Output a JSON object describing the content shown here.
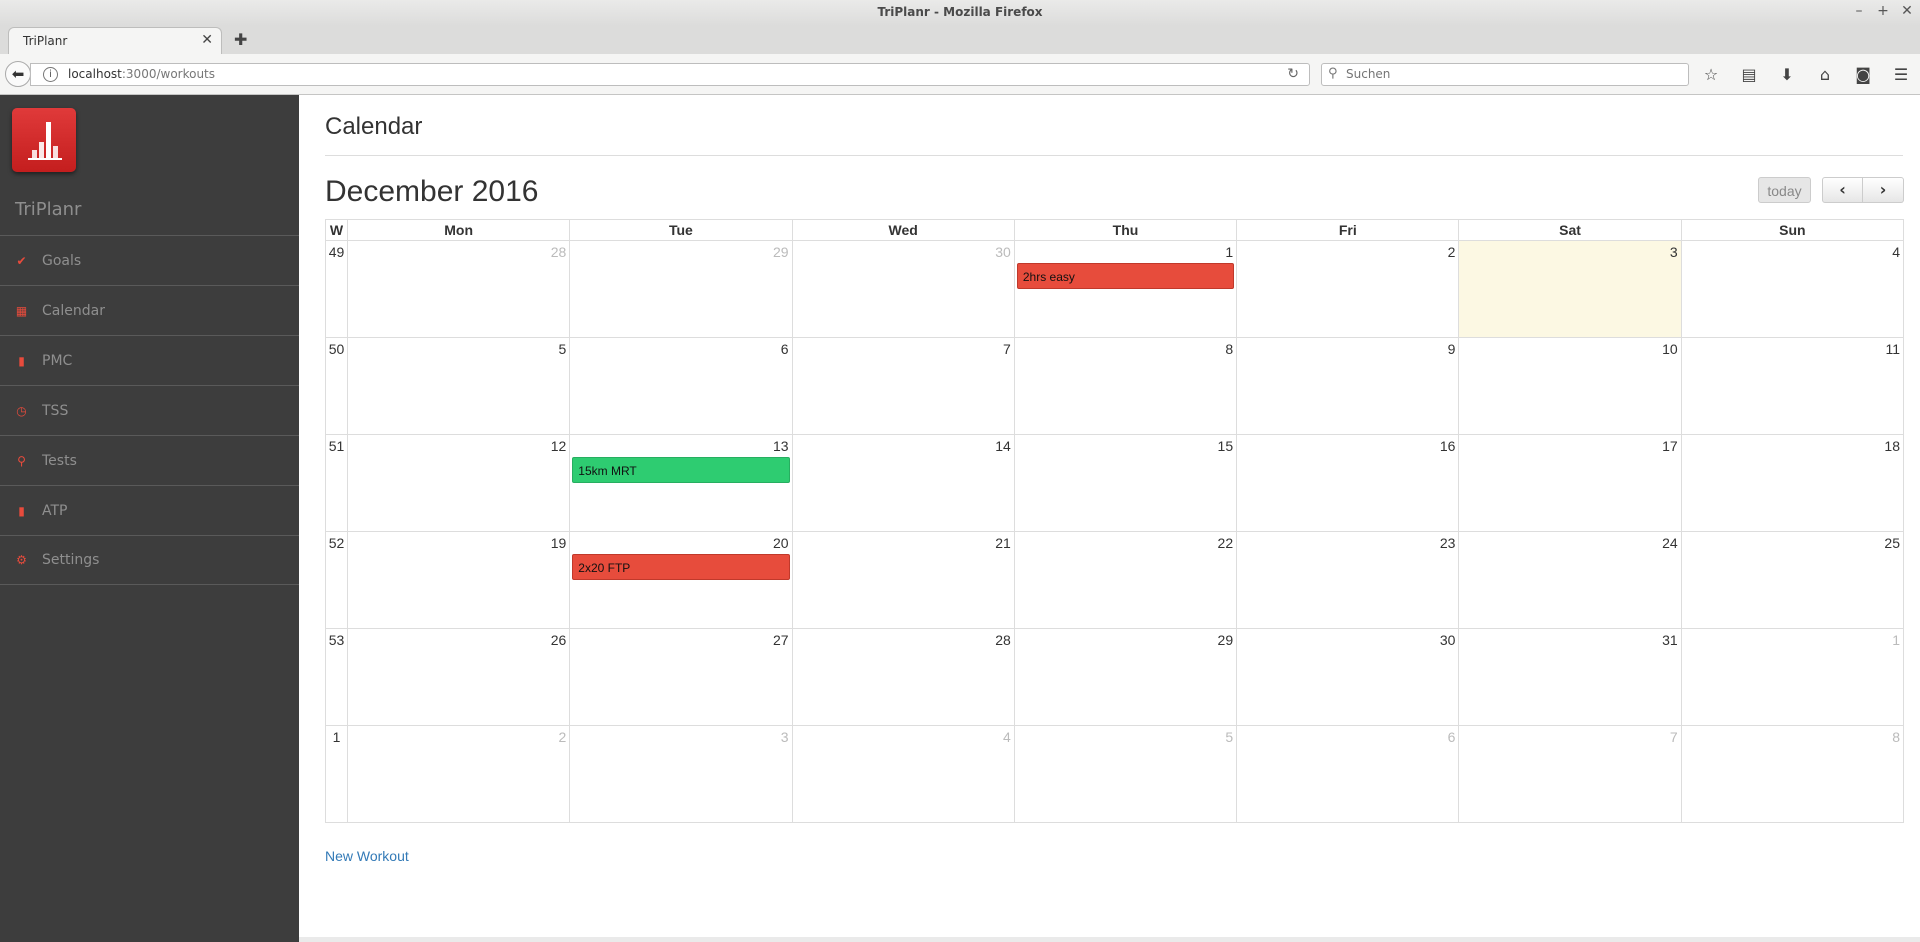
{
  "window": {
    "title": "TriPlanr - Mozilla Firefox"
  },
  "browser": {
    "tab_title": "TriPlanr",
    "url_host": "localhost",
    "url_path": ":3000/workouts",
    "search_placeholder": "Suchen"
  },
  "sidebar": {
    "brand": "TriPlanr",
    "items": [
      {
        "label": "Goals",
        "icon": "check-circle-icon"
      },
      {
        "label": "Calendar",
        "icon": "calendar-icon"
      },
      {
        "label": "PMC",
        "icon": "signal-bars-icon"
      },
      {
        "label": "TSS",
        "icon": "dashboard-icon"
      },
      {
        "label": "Tests",
        "icon": "search-icon"
      },
      {
        "label": "ATP",
        "icon": "bar-chart-icon"
      },
      {
        "label": "Settings",
        "icon": "gear-icon"
      }
    ]
  },
  "main": {
    "page_title": "Calendar",
    "month_title": "December 2016",
    "today_label": "today",
    "prev_label": "‹",
    "next_label": "›",
    "new_workout_label": "New Workout"
  },
  "calendar": {
    "headers": [
      "W",
      "Mon",
      "Tue",
      "Wed",
      "Thu",
      "Fri",
      "Sat",
      "Sun"
    ],
    "weeks": [
      {
        "week": "49",
        "days": [
          {
            "d": "28",
            "other": true
          },
          {
            "d": "29",
            "other": true
          },
          {
            "d": "30",
            "other": true
          },
          {
            "d": "1",
            "event": {
              "title": "2hrs easy",
              "color": "#e74c3c"
            }
          },
          {
            "d": "2"
          },
          {
            "d": "3",
            "today": true
          },
          {
            "d": "4"
          }
        ]
      },
      {
        "week": "50",
        "days": [
          {
            "d": "5"
          },
          {
            "d": "6"
          },
          {
            "d": "7"
          },
          {
            "d": "8"
          },
          {
            "d": "9"
          },
          {
            "d": "10"
          },
          {
            "d": "11"
          }
        ]
      },
      {
        "week": "51",
        "days": [
          {
            "d": "12"
          },
          {
            "d": "13",
            "event": {
              "title": "15km MRT",
              "color": "#2ecc71"
            }
          },
          {
            "d": "14"
          },
          {
            "d": "15"
          },
          {
            "d": "16"
          },
          {
            "d": "17"
          },
          {
            "d": "18"
          }
        ]
      },
      {
        "week": "52",
        "days": [
          {
            "d": "19"
          },
          {
            "d": "20",
            "event": {
              "title": "2x20 FTP",
              "color": "#e74c3c"
            }
          },
          {
            "d": "21"
          },
          {
            "d": "22"
          },
          {
            "d": "23"
          },
          {
            "d": "24"
          },
          {
            "d": "25"
          }
        ]
      },
      {
        "week": "53",
        "days": [
          {
            "d": "26"
          },
          {
            "d": "27"
          },
          {
            "d": "28"
          },
          {
            "d": "29"
          },
          {
            "d": "30"
          },
          {
            "d": "31"
          },
          {
            "d": "1",
            "other": true
          }
        ]
      },
      {
        "week": "1",
        "days": [
          {
            "d": "2",
            "other": true
          },
          {
            "d": "3",
            "other": true
          },
          {
            "d": "4",
            "other": true
          },
          {
            "d": "5",
            "other": true
          },
          {
            "d": "6",
            "other": true
          },
          {
            "d": "7",
            "other": true
          },
          {
            "d": "8",
            "other": true
          }
        ]
      }
    ]
  },
  "colors": {
    "accent": "#e84b3c",
    "today_bg": "#fcf8e3",
    "sidebar_bg": "#3d3d3d",
    "link": "#337ab7"
  }
}
